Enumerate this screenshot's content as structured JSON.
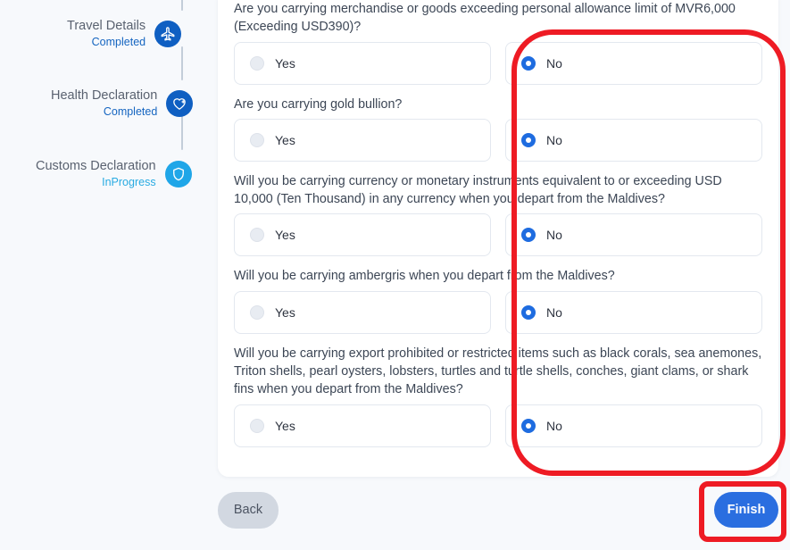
{
  "colors": {
    "page_background": "#f7f9fc",
    "card_background": "#ffffff",
    "accent_blue": "#2a6ee0",
    "step_done_blue": "#0f5fc2",
    "step_active_blue": "#1fa6e8",
    "completed_text": "#1565c0",
    "inprogress_text": "#29abe2",
    "annotation_red": "#ee1b24",
    "back_button_grey": "#d2d8e1"
  },
  "stepper": {
    "steps": [
      {
        "title": "Travel Details",
        "status": "Completed",
        "icon": "airplane-icon",
        "state": "done"
      },
      {
        "title": "Health Declaration",
        "status": "Completed",
        "icon": "heart-shield-icon",
        "state": "done"
      },
      {
        "title": "Customs Declaration",
        "status": "InProgress",
        "icon": "shield-icon",
        "state": "active"
      }
    ]
  },
  "form": {
    "questions": [
      {
        "text": "Are you carrying merchandise or goods exceeding personal allowance limit of MVR6,000 (Exceeding USD390)?",
        "options": [
          {
            "label": "Yes",
            "selected": false
          },
          {
            "label": "No",
            "selected": true
          }
        ]
      },
      {
        "text": "Are you carrying gold bullion?",
        "options": [
          {
            "label": "Yes",
            "selected": false
          },
          {
            "label": "No",
            "selected": true
          }
        ]
      },
      {
        "text": "Will you be carrying currency or monetary instruments equivalent to or exceeding USD 10,000 (Ten Thousand) in any currency when you depart from the Maldives?",
        "options": [
          {
            "label": "Yes",
            "selected": false
          },
          {
            "label": "No",
            "selected": true
          }
        ]
      },
      {
        "text": "Will you be carrying ambergris when you depart from the Maldives?",
        "options": [
          {
            "label": "Yes",
            "selected": false
          },
          {
            "label": "No",
            "selected": true
          }
        ]
      },
      {
        "text": "Will you be carrying export prohibited or restricted items such as black corals, sea anemones, Triton shells, pearl oysters, lobsters, turtles and turtle shells, conches, giant clams, or shark fins when you depart from the Maldives?",
        "options": [
          {
            "label": "Yes",
            "selected": false
          },
          {
            "label": "No",
            "selected": true
          }
        ]
      }
    ]
  },
  "footer": {
    "back_label": "Back",
    "finish_label": "Finish"
  },
  "annotations": [
    {
      "name": "no-column-highlight",
      "shape": "rounded-rect"
    },
    {
      "name": "finish-button-highlight",
      "shape": "rounded-rect"
    }
  ]
}
